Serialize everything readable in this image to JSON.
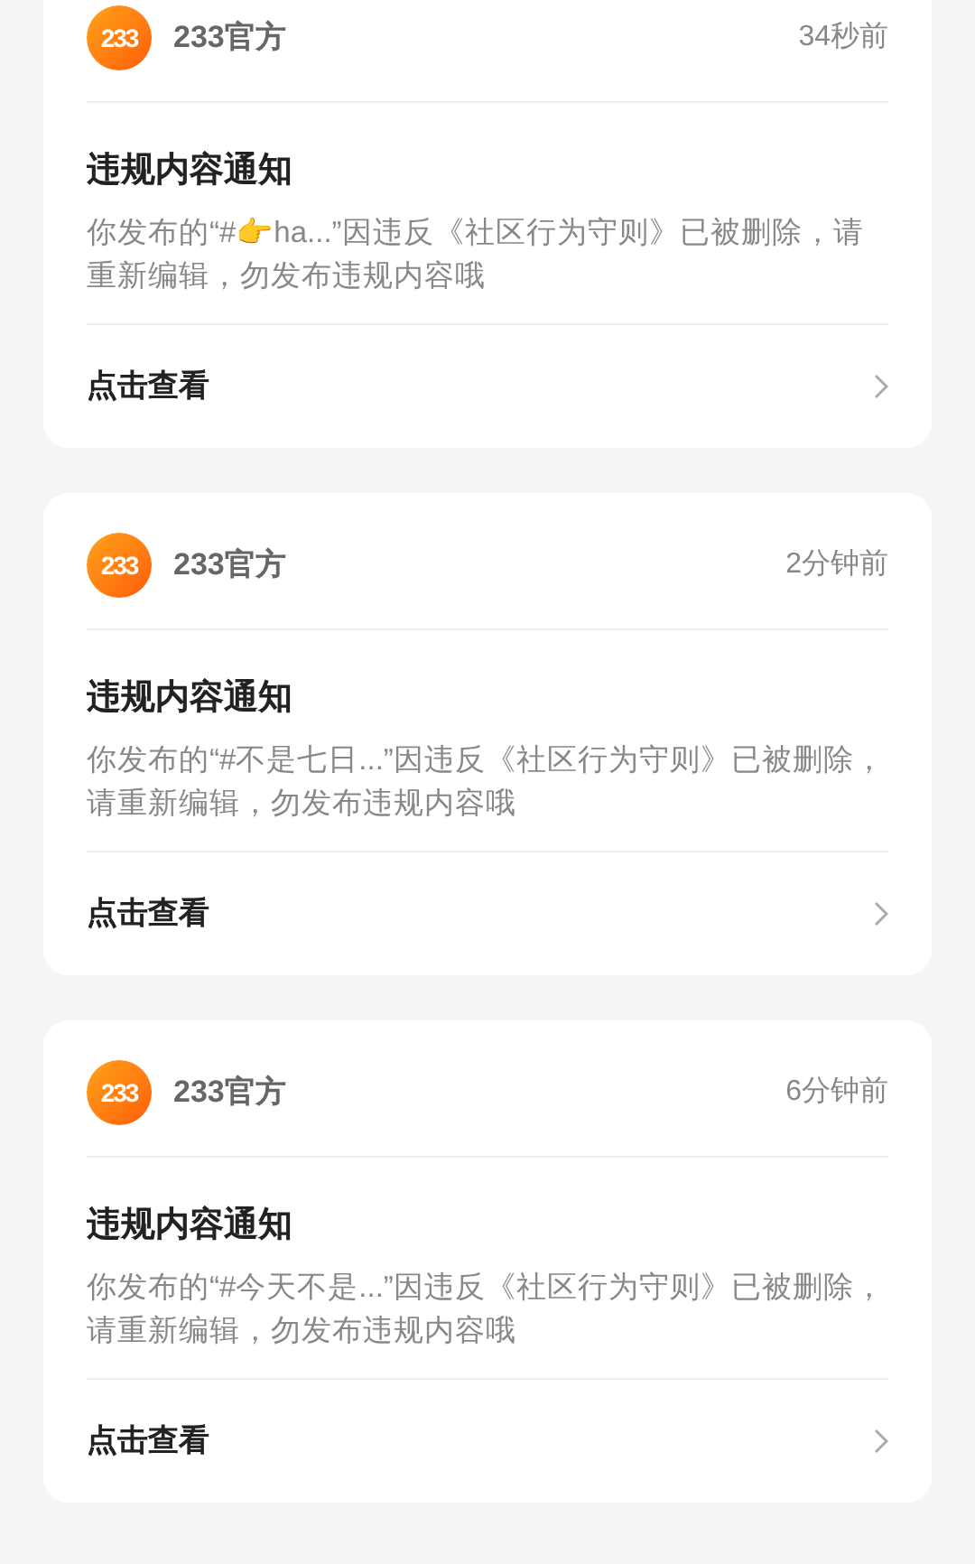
{
  "notices": [
    {
      "logo_text": "233",
      "sender": "233官方",
      "time": "34秒前",
      "title": "违规内容通知",
      "body": "你发布的“#👉ha...”因违反《社区行为守则》已被删除，请重新编辑，勿发布违规内容哦",
      "action": "点击查看"
    },
    {
      "logo_text": "233",
      "sender": "233官方",
      "time": "2分钟前",
      "title": "违规内容通知",
      "body": "你发布的“#不是七日...”因违反《社区行为守则》已被删除，请重新编辑，勿发布违规内容哦",
      "action": "点击查看"
    },
    {
      "logo_text": "233",
      "sender": "233官方",
      "time": "6分钟前",
      "title": "违规内容通知",
      "body": "你发布的“#今天不是...”因违反《社区行为守则》已被删除，请重新编辑，勿发布违规内容哦",
      "action": "点击查看"
    }
  ]
}
